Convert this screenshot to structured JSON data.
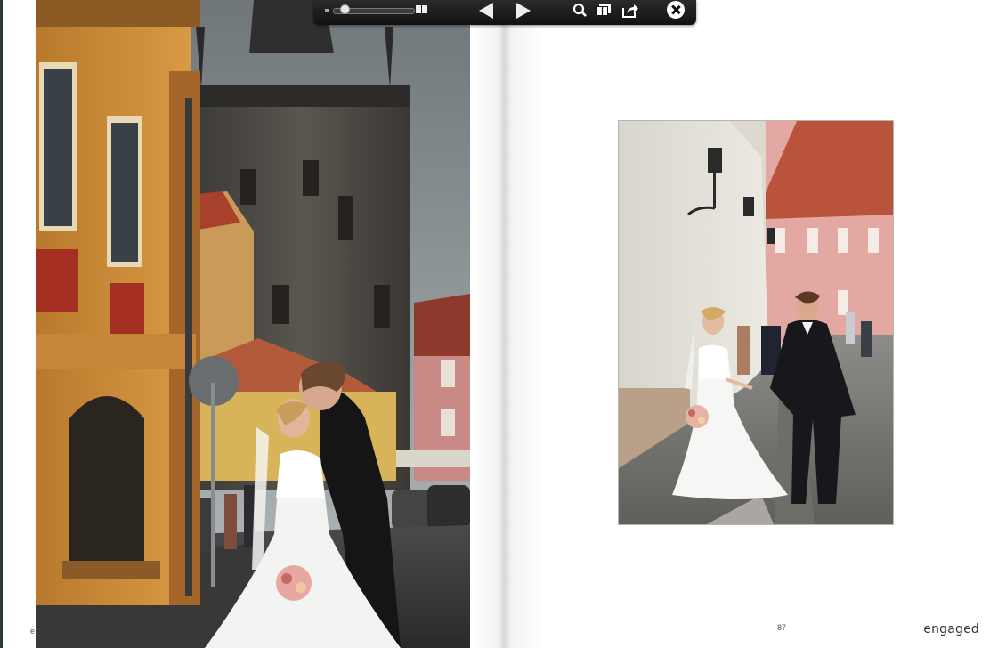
{
  "toolbar": {
    "zoom_level": 0.1,
    "icons": {
      "zoom_slider": "zoom-slider",
      "two_page_view": "two-page-view-icon",
      "previous": "previous-page-arrow-icon",
      "next": "next-page-arrow-icon",
      "search": "search-icon",
      "thumbnails": "thumbnails-icon",
      "share": "share-icon",
      "close": "close-icon"
    }
  },
  "spread": {
    "left_page": {
      "page_number": "e",
      "photo": "bride-and-groom-kissing-on-prague-street-with-tower"
    },
    "right_page": {
      "page_number": "87",
      "photo": "bride-and-groom-walking-hand-in-hand-on-cobblestone-lane",
      "brand": "engaged"
    }
  },
  "colors": {
    "toolbar_bg": "#1a1a1a",
    "page_bg": "#ffffff",
    "left_edge": "#2c3a36"
  }
}
